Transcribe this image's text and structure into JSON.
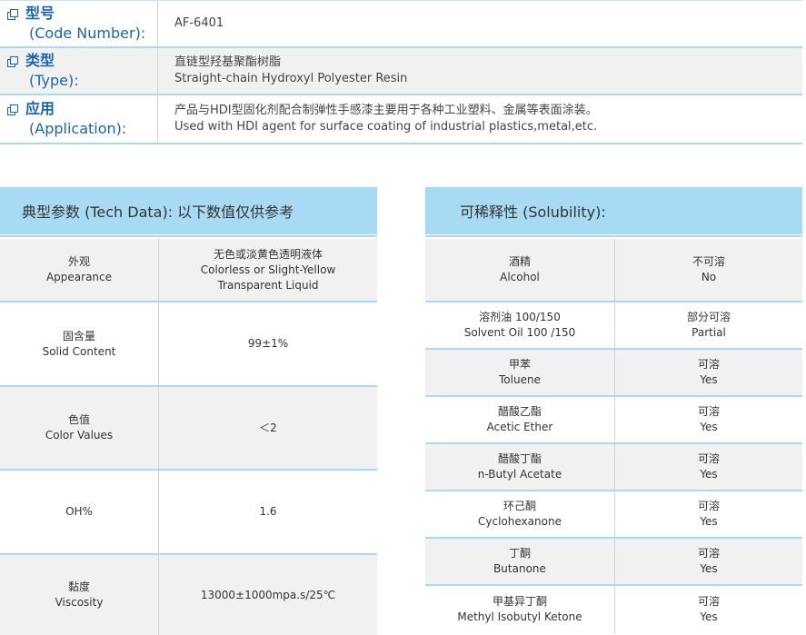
{
  "info": [
    {
      "label_cn": "型号",
      "label_en": "(Code Number):",
      "value_lines": [
        "AF-6401"
      ]
    },
    {
      "label_cn": "类型",
      "label_en": "(Type):",
      "value_lines": [
        "直链型羟基聚酯树脂",
        "Straight-chain Hydroxyl Polyester Resin"
      ]
    },
    {
      "label_cn": "应用",
      "label_en": "(Application):",
      "value_lines": [
        "产品与HDI型固化剂配合制弹性手感漆主要用于各种工业塑料、金属等表面涂装。",
        "Used with HDI agent for surface coating of industrial plastics,metal,etc."
      ]
    }
  ],
  "tech": {
    "title": "典型参数 (Tech Data): 以下数值仅供参考",
    "rows": [
      {
        "name_cn": "外观",
        "name_en": "Appearance",
        "value_lines": [
          "无色或淡黄色透明液体",
          "Colorless or Slight-Yellow",
          "Transparent Liquid"
        ]
      },
      {
        "name_cn": "固含量",
        "name_en": "Solid Content",
        "value_lines": [
          "99±1%"
        ]
      },
      {
        "name_cn": "色值",
        "name_en": "Color Values",
        "value_lines": [
          "＜2"
        ]
      },
      {
        "name_cn": "",
        "name_en": "OH%",
        "value_lines": [
          "1.6"
        ]
      },
      {
        "name_cn": "黏度",
        "name_en": "Viscosity",
        "value_lines": [
          "13000±1000mpa.s/25℃"
        ]
      }
    ]
  },
  "solubility": {
    "title": "可稀释性 (Solubility):",
    "rows": [
      {
        "name_cn": "酒精",
        "name_en": "Alcohol",
        "val_cn": "不可溶",
        "val_en": "No"
      },
      {
        "name_cn": "溶剂油 100/150",
        "name_en": "Solvent Oil 100 /150",
        "val_cn": "部分可溶",
        "val_en": "Partial"
      },
      {
        "name_cn": "甲苯",
        "name_en": "Toluene",
        "val_cn": "可溶",
        "val_en": "Yes"
      },
      {
        "name_cn": "醋酸乙酯",
        "name_en": "Acetic Ether",
        "val_cn": "可溶",
        "val_en": "Yes"
      },
      {
        "name_cn": "醋酸丁酯",
        "name_en": "n-Butyl Acetate",
        "val_cn": "可溶",
        "val_en": "Yes"
      },
      {
        "name_cn": "环己酮",
        "name_en": "Cyclohexanone",
        "val_cn": "可溶",
        "val_en": "Yes"
      },
      {
        "name_cn": "丁酮",
        "name_en": "Butanone",
        "val_cn": "可溶",
        "val_en": "Yes"
      },
      {
        "name_cn": "甲基异丁酮",
        "name_en": "Methyl Isobutyl Ketone",
        "val_cn": "可溶",
        "val_en": "Yes"
      }
    ]
  },
  "colors": {
    "accent": "#1b64b0",
    "header_bg": "#a8dbf3",
    "rule": "#a9d9f3",
    "shade": "#f1f1f1"
  },
  "icons": {
    "label_icon": "square-stack-icon"
  }
}
